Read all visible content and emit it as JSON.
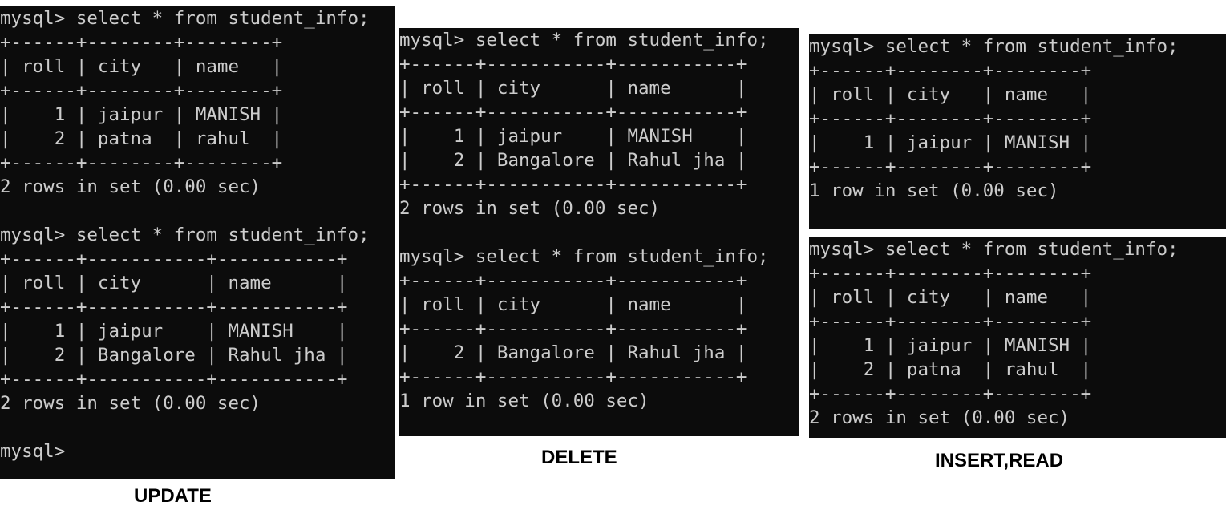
{
  "colors": {
    "terminal_bg": "#0c0c0c",
    "terminal_fg": "#cccccc",
    "page_bg": "#ffffff",
    "caption": "#000000"
  },
  "terminals": {
    "update": [
      "mysql> select * from student_info;",
      "+------+--------+--------+",
      "| roll | city   | name   |",
      "+------+--------+--------+",
      "|    1 | jaipur | MANISH |",
      "|    2 | patna  | rahul  |",
      "+------+--------+--------+",
      "2 rows in set (0.00 sec)",
      "",
      "mysql> select * from student_info;",
      "+------+-----------+-----------+",
      "| roll | city      | name      |",
      "+------+-----------+-----------+",
      "|    1 | jaipur    | MANISH    |",
      "|    2 | Bangalore | Rahul jha |",
      "+------+-----------+-----------+",
      "2 rows in set (0.00 sec)",
      "",
      "mysql>"
    ],
    "delete": [
      "mysql> select * from student_info;",
      "+------+-----------+-----------+",
      "| roll | city      | name      |",
      "+------+-----------+-----------+",
      "|    1 | jaipur    | MANISH    |",
      "|    2 | Bangalore | Rahul jha |",
      "+------+-----------+-----------+",
      "2 rows in set (0.00 sec)",
      "",
      "mysql> select * from student_info;",
      "+------+-----------+-----------+",
      "| roll | city      | name      |",
      "+------+-----------+-----------+",
      "|    2 | Bangalore | Rahul jha |",
      "+------+-----------+-----------+",
      "1 row in set (0.00 sec)"
    ],
    "insert": [
      "mysql> select * from student_info;",
      "+------+--------+--------+",
      "| roll | city   | name   |",
      "+------+--------+--------+",
      "|    1 | jaipur | MANISH |",
      "+------+--------+--------+",
      "1 row in set (0.00 sec)"
    ],
    "read": [
      "mysql> select * from student_info;",
      "+------+--------+--------+",
      "| roll | city   | name   |",
      "+------+--------+--------+",
      "|    1 | jaipur | MANISH |",
      "|    2 | patna  | rahul  |",
      "+------+--------+--------+",
      "2 rows in set (0.00 sec)"
    ]
  },
  "captions": {
    "update": "UPDATE",
    "delete": "DELETE",
    "insert_read": "INSERT,READ"
  }
}
